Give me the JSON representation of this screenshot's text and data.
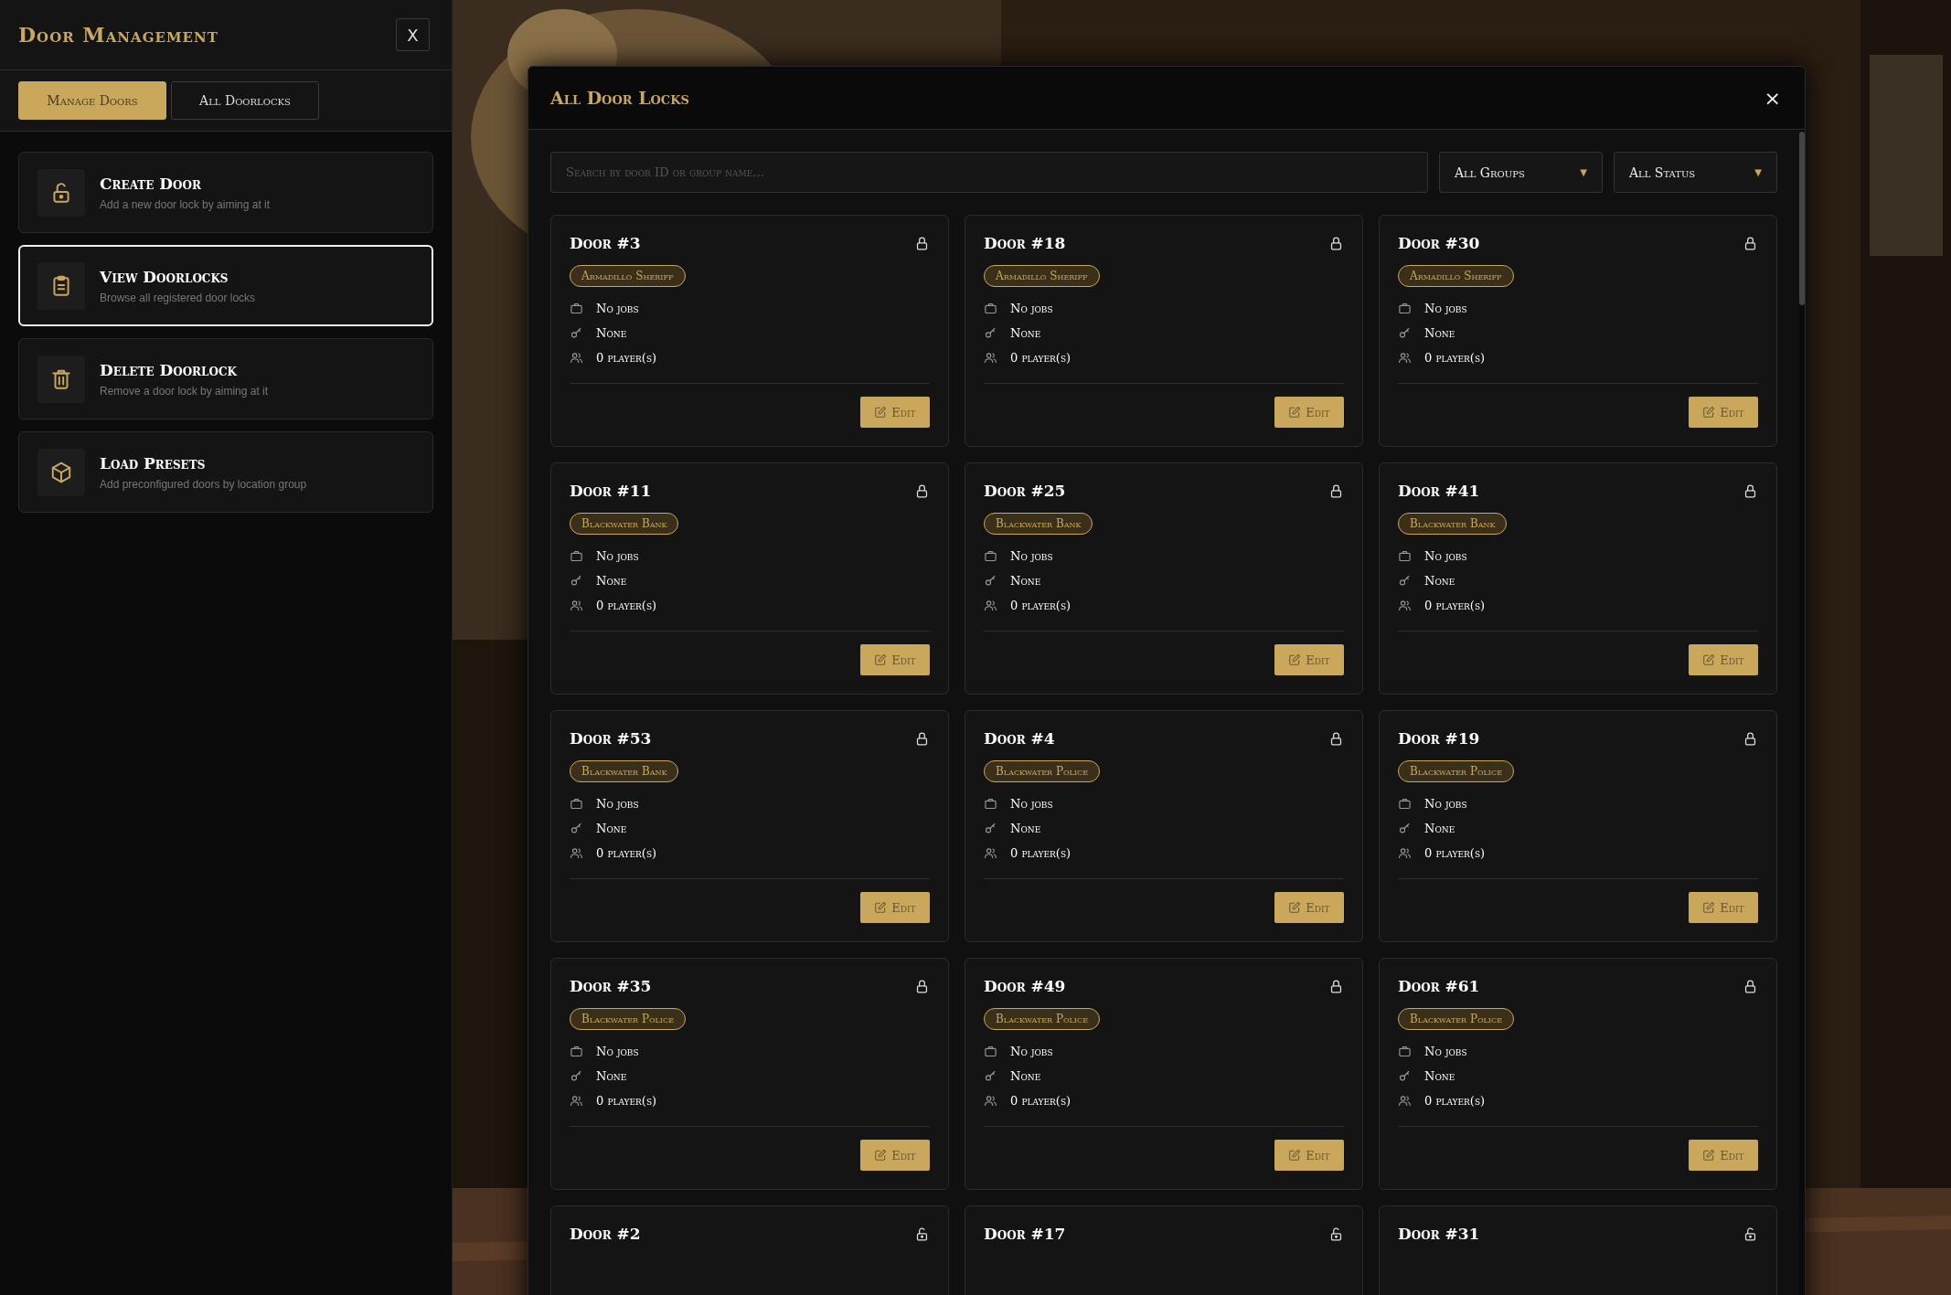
{
  "sidebar": {
    "title": "Door Management",
    "close": "X",
    "tabs": [
      {
        "label": "Manage Doors",
        "selected": true
      },
      {
        "label": "All Doorlocks",
        "selected": false
      }
    ],
    "menu": [
      {
        "title": "Create Door",
        "description": "Add a new door lock by aiming at it",
        "selected": false
      },
      {
        "title": "View Doorlocks",
        "description": "Browse all registered door locks",
        "selected": true
      },
      {
        "title": "Delete Doorlock",
        "description": "Remove a door lock by aiming at it",
        "selected": false
      },
      {
        "title": "Load Presets",
        "description": "Add preconfigured doors by location group",
        "selected": false
      }
    ]
  },
  "modal": {
    "title": "All Door Locks",
    "close": "×",
    "search": {
      "placeholder": "Search by door ID or group name..."
    },
    "filters": [
      {
        "value": "All Groups",
        "caret": "▼"
      },
      {
        "value": "All Status",
        "caret": "▼"
      }
    ],
    "doors": [
      {
        "title": "Door #3",
        "locked": true,
        "group": "Armadillo Sheriff",
        "jobs": "No jobs",
        "access": "None",
        "players": "0 player(s)",
        "edit": "Edit"
      },
      {
        "title": "Door #18",
        "locked": true,
        "group": "Armadillo Sheriff",
        "jobs": "No jobs",
        "access": "None",
        "players": "0 player(s)",
        "edit": "Edit"
      },
      {
        "title": "Door #30",
        "locked": true,
        "group": "Armadillo Sheriff",
        "jobs": "No jobs",
        "access": "None",
        "players": "0 player(s)",
        "edit": "Edit"
      },
      {
        "title": "Door #11",
        "locked": true,
        "group": "Blackwater Bank",
        "jobs": "No jobs",
        "access": "None",
        "players": "0 player(s)",
        "edit": "Edit"
      },
      {
        "title": "Door #25",
        "locked": true,
        "group": "Blackwater Bank",
        "jobs": "No jobs",
        "access": "None",
        "players": "0 player(s)",
        "edit": "Edit"
      },
      {
        "title": "Door #41",
        "locked": true,
        "group": "Blackwater Bank",
        "jobs": "No jobs",
        "access": "None",
        "players": "0 player(s)",
        "edit": "Edit"
      },
      {
        "title": "Door #53",
        "locked": true,
        "group": "Blackwater Bank",
        "jobs": "No jobs",
        "access": "None",
        "players": "0 player(s)",
        "edit": "Edit"
      },
      {
        "title": "Door #4",
        "locked": true,
        "group": "Blackwater Police",
        "jobs": "No jobs",
        "access": "None",
        "players": "0 player(s)",
        "edit": "Edit"
      },
      {
        "title": "Door #19",
        "locked": true,
        "group": "Blackwater Police",
        "jobs": "No jobs",
        "access": "None",
        "players": "0 player(s)",
        "edit": "Edit"
      },
      {
        "title": "Door #35",
        "locked": true,
        "group": "Blackwater Police",
        "jobs": "No jobs",
        "access": "None",
        "players": "0 player(s)",
        "edit": "Edit"
      },
      {
        "title": "Door #49",
        "locked": true,
        "group": "Blackwater Police",
        "jobs": "No jobs",
        "access": "None",
        "players": "0 player(s)",
        "edit": "Edit"
      },
      {
        "title": "Door #61",
        "locked": true,
        "group": "Blackwater Police",
        "jobs": "No jobs",
        "access": "None",
        "players": "0 player(s)",
        "edit": "Edit"
      },
      {
        "title": "Door #2",
        "locked": false
      },
      {
        "title": "Door #17",
        "locked": false
      },
      {
        "title": "Door #31",
        "locked": false
      }
    ]
  }
}
